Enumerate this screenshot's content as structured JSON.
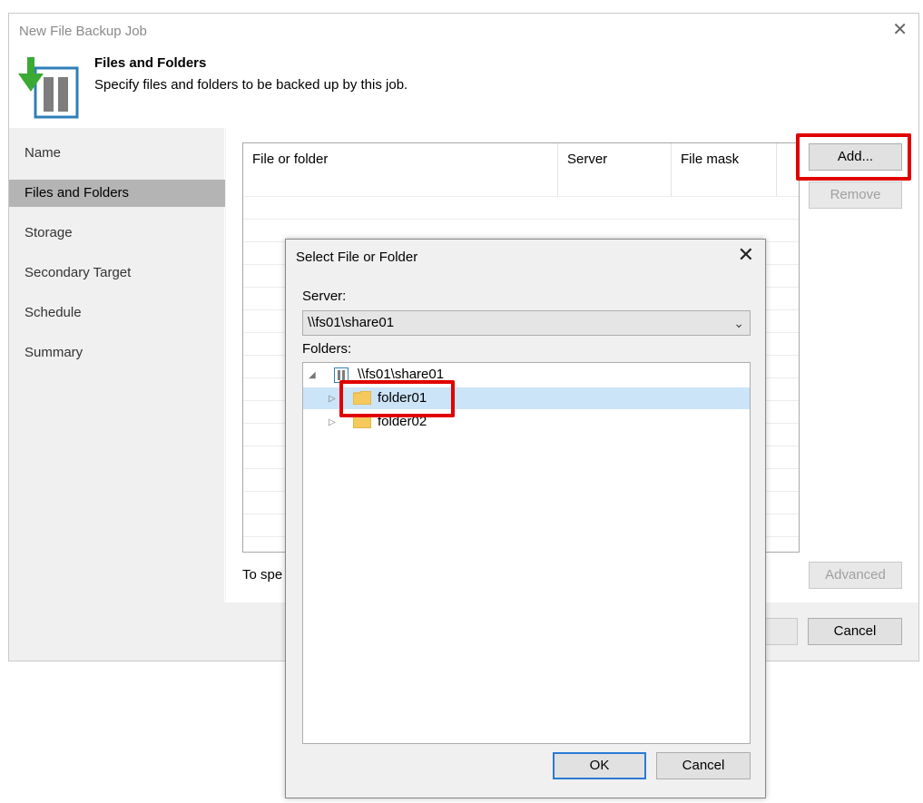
{
  "window": {
    "title": "New File Backup Job",
    "close_glyph": "✕"
  },
  "header": {
    "title": "Files and Folders",
    "subtitle": "Specify files and folders to be backed up by this job.",
    "icon": "backup-job-icon"
  },
  "nav": {
    "items": [
      {
        "label": "Name"
      },
      {
        "label": "Files and Folders",
        "active": true
      },
      {
        "label": "Storage"
      },
      {
        "label": "Secondary Target"
      },
      {
        "label": "Schedule"
      },
      {
        "label": "Summary"
      }
    ]
  },
  "grid": {
    "columns": [
      "File or folder",
      "Server",
      "File mask"
    ]
  },
  "content": {
    "hint_text": "To spe",
    "add_label": "Add...",
    "remove_label": "Remove",
    "advanced_label": "Advanced"
  },
  "footer": {
    "cancel_label": "Cancel"
  },
  "dialog": {
    "title": "Select File or Folder",
    "close_glyph": "✕",
    "server_label": "Server:",
    "server_value": "\\\\fs01\\share01",
    "folders_label": "Folders:",
    "tree": [
      {
        "label": "\\\\fs01\\share01",
        "expander": "◢",
        "icon": "share-icon"
      },
      {
        "label": "folder01",
        "expander": "▷",
        "icon": "folder-icon",
        "selected": true
      },
      {
        "label": "folder02",
        "expander": "▷",
        "icon": "folder-icon"
      }
    ],
    "ok_label": "OK",
    "cancel_label": "Cancel"
  },
  "colors": {
    "highlight": "#e00000",
    "selection": "#cce4f7",
    "accent": "#2a7bd4",
    "folder": "#f5c95b"
  }
}
